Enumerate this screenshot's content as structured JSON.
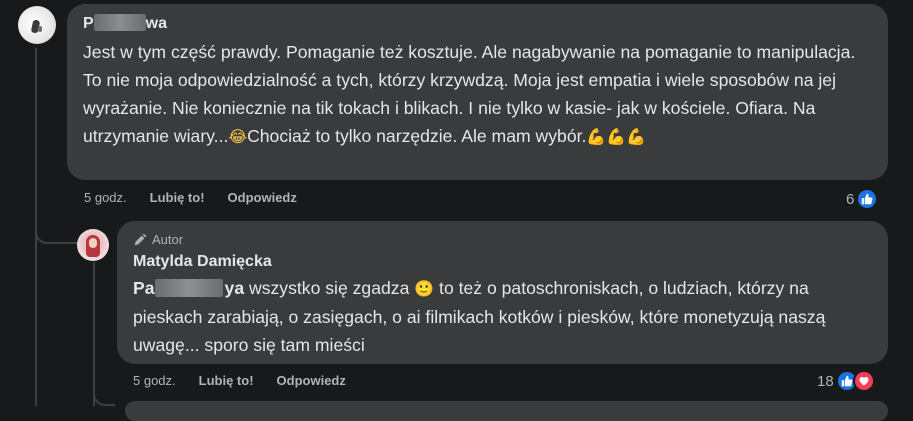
{
  "comments": [
    {
      "author": "P",
      "author_tail": "wa",
      "text_main": "Jest w tym część prawdy. Pomaganie też kosztuje. Ale nagabywanie na pomaganie to manipulacja. To nie moja odpowiedzialność a tych, którzy krzywdzą. Moja jest empatia i wiele sposobów na jej wyrażanie. Nie koniecznie na tik tokach i blikach. I nie tylko w kasie- jak w kościele. Ofiara. Na utrzymanie wiary...",
      "emoji_1": "😂",
      "text_after_emoji": "Chociaż to tylko narzędzie. Ale mam wybór.",
      "emoji_tail": "💪💪💪",
      "time": "5 godz.",
      "like_label": "Lubię to!",
      "reply_label": "Odpowiedz",
      "reaction_count": "6",
      "reaction_icons": [
        "like-icon"
      ]
    },
    {
      "badge": "Autor",
      "author": "Matylda Damięcka",
      "mention_head": "Pa",
      "mention_tail": "ya",
      "text_1": " wszystko się zgadza ",
      "emoji_1": "🙂",
      "text_2": " to też o patoschroniskach, o ludziach, którzy na pieskach zarabiają, o zasięgach, o ai filmikach kotków i piesków, które monetyzują naszą uwagę... sporo się tam mieści",
      "time": "5 godz.",
      "like_label": "Lubię to!",
      "reply_label": "Odpowiedz",
      "reaction_count": "18",
      "reaction_icons": [
        "like-icon",
        "love-icon"
      ]
    }
  ],
  "colors": {
    "background": "#18191a",
    "bubble": "#3a3b3c",
    "text": "#e4e6eb",
    "secondary_text": "#b0b3b8",
    "like_blue": "#1b74e4",
    "love_red": "#f33e58"
  }
}
